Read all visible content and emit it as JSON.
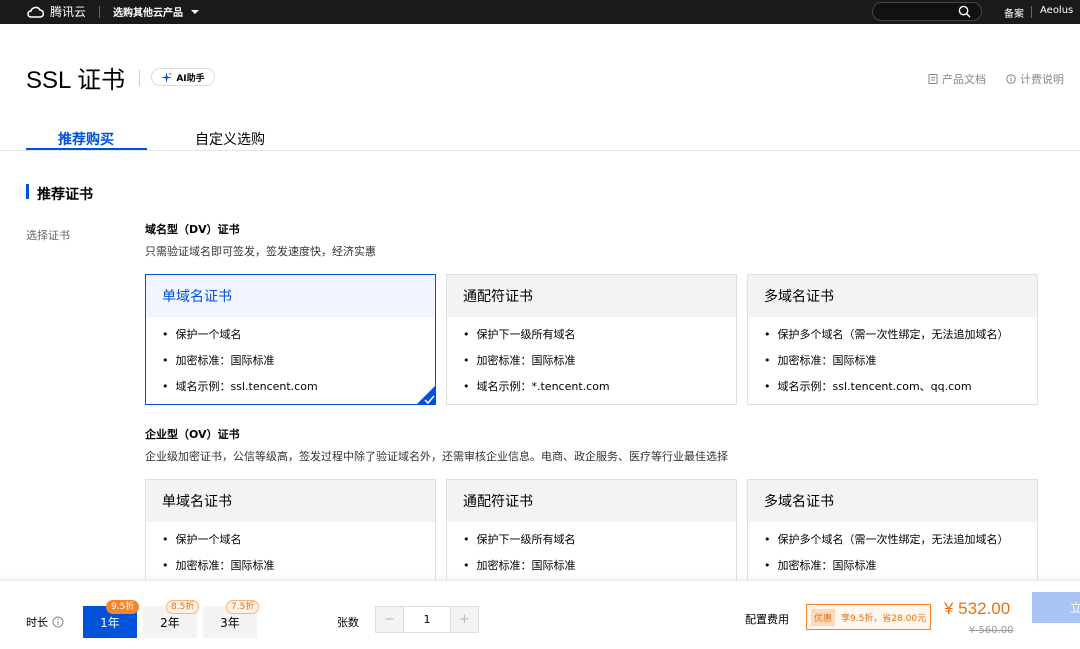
{
  "topbar": {
    "brand": "腾讯云",
    "product_menu": "选购其他云产品",
    "search_placeholder": "",
    "beian": "备案",
    "user": "Aeolus"
  },
  "header": {
    "title": "SSL 证书",
    "ai_button": "AI助手",
    "doc_link": "产品文档",
    "billing_link": "计费说明"
  },
  "tabs": [
    {
      "label": "推荐购买",
      "active": true
    },
    {
      "label": "自定义选购",
      "active": false
    }
  ],
  "section": {
    "title": "推荐证书",
    "left_label": "选择证书"
  },
  "groups": [
    {
      "title": "域名型（DV）证书",
      "desc": "只需验证域名即可签发，签发速度快，经济实惠",
      "cards": [
        {
          "name": "单域名证书",
          "selected": true,
          "features": [
            "保护一个域名",
            "加密标准：国际标准",
            "域名示例：ssl.tencent.com"
          ]
        },
        {
          "name": "通配符证书",
          "selected": false,
          "features": [
            "保护下一级所有域名",
            "加密标准：国际标准",
            "域名示例：*.tencent.com"
          ]
        },
        {
          "name": "多域名证书",
          "selected": false,
          "features": [
            "保护多个域名（需一次性绑定，无法追加域名）",
            "加密标准：国际标准",
            "域名示例：ssl.tencent.com、qq.com"
          ]
        }
      ]
    },
    {
      "title": "企业型（OV）证书",
      "desc": "企业级加密证书，公信等级高，签发过程中除了验证域名外，还需审核企业信息。电商、政企服务、医疗等行业最佳选择",
      "cards": [
        {
          "name": "单域名证书",
          "selected": false,
          "features": [
            "保护一个域名",
            "加密标准：国际标准"
          ]
        },
        {
          "name": "通配符证书",
          "selected": false,
          "features": [
            "保护下一级所有域名",
            "加密标准：国际标准"
          ]
        },
        {
          "name": "多域名证书",
          "selected": false,
          "features": [
            "保护多个域名（需一次性绑定，无法追加域名）",
            "加密标准：国际标准"
          ]
        }
      ]
    }
  ],
  "bottombar": {
    "duration_label": "时长",
    "durations": [
      {
        "label": "1年",
        "discount": "9.5折",
        "active": true
      },
      {
        "label": "2年",
        "discount": "8.5折",
        "active": false
      },
      {
        "label": "3年",
        "discount": "7.5折",
        "active": false
      }
    ],
    "quantity_label": "张数",
    "quantity_minus": "−",
    "quantity_value": "1",
    "quantity_plus": "+",
    "fee_label": "配置费用",
    "promo_tag": "优惠",
    "promo_text": "享9.5折，省28.00元",
    "price": "¥ 532.00",
    "original_price": "¥ 560.00",
    "buy_button": "立"
  },
  "colors": {
    "brand_blue": "#0052d9",
    "accent_orange": "#e37318",
    "topbar_bg": "#1a1a1a"
  }
}
